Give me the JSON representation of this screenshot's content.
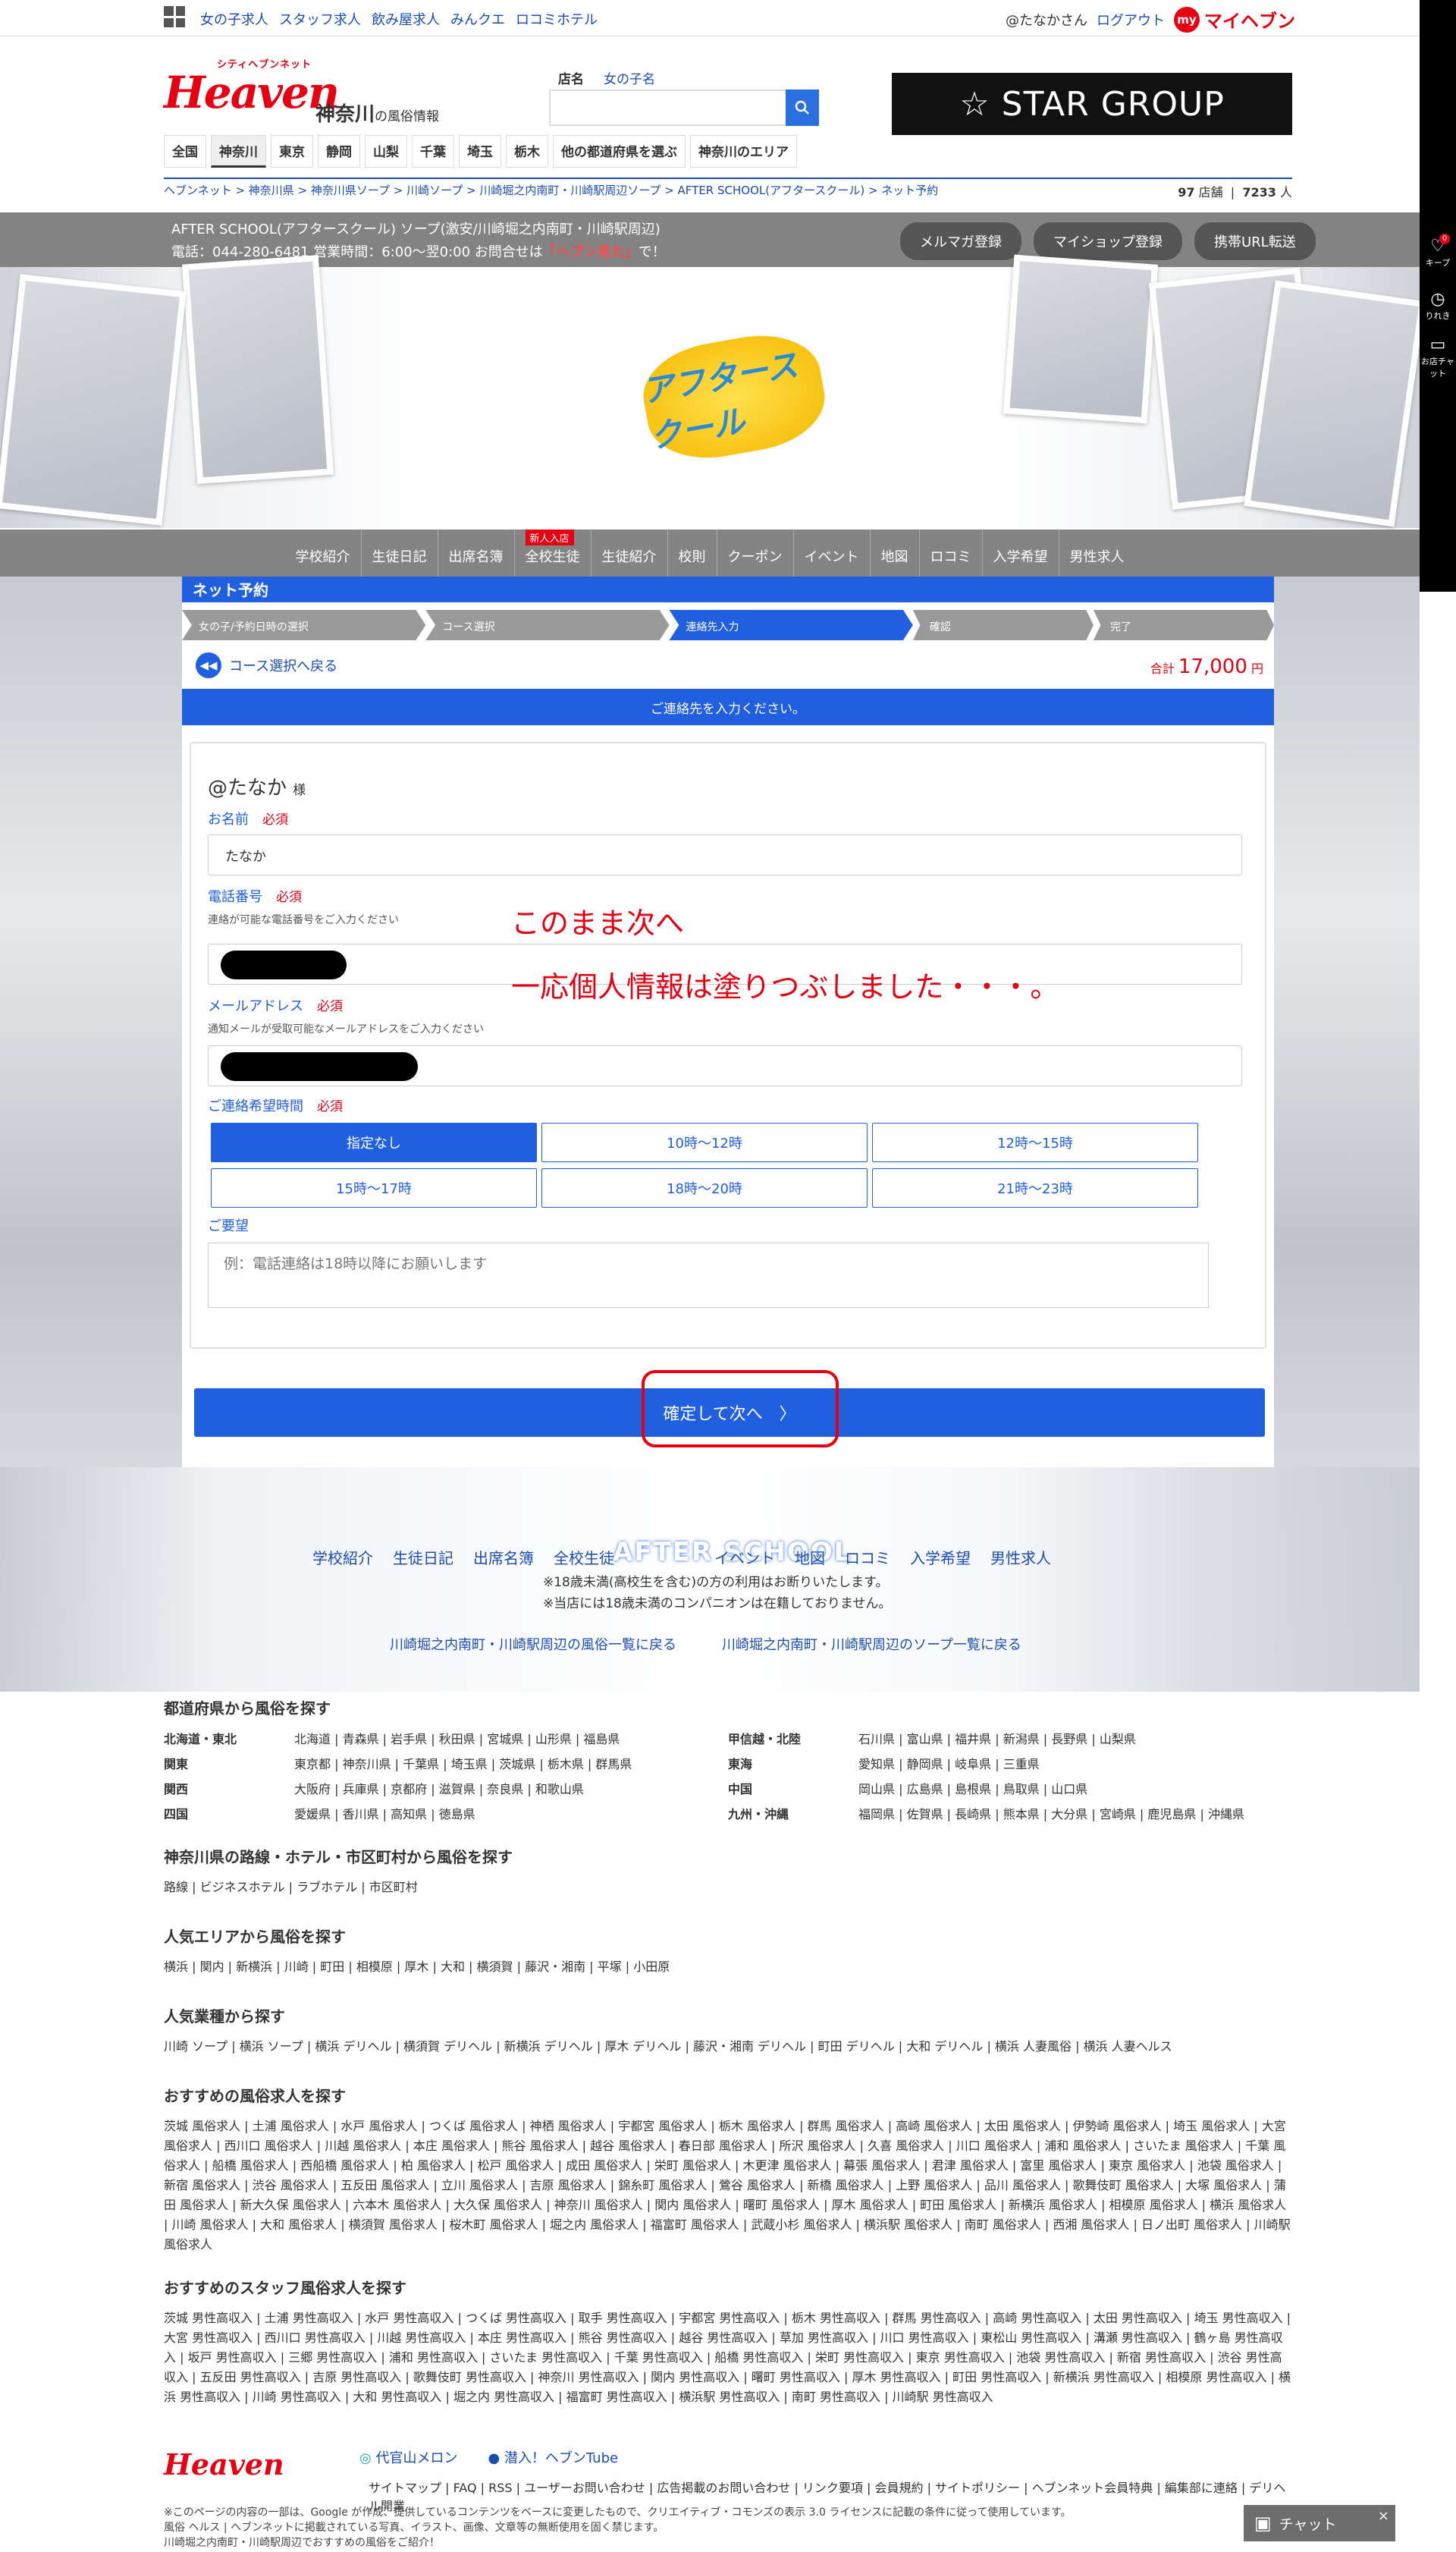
{
  "topbar": {
    "nav": [
      "女の子求人",
      "スタッフ求人",
      "飲み屋求人",
      "みんクエ",
      "ロコミホテル"
    ],
    "user": "@たなかさん",
    "logout": "ログアウト",
    "myheaven_icon": "my",
    "myheaven": "マイヘブン"
  },
  "header": {
    "logo_small": "シティヘブンネット",
    "logo": "Heaven",
    "region": "神奈川",
    "region_suffix": "の風俗情報",
    "search_tabs": [
      "店名",
      "女の子名"
    ],
    "banner": "☆ STAR GROUP",
    "prefs": [
      "全国",
      "神奈川",
      "東京",
      "静岡",
      "山梨",
      "千葉",
      "埼玉",
      "栃木",
      "他の都道府県を選ぶ",
      "神奈川のエリア"
    ]
  },
  "breadcrumb": {
    "text": "ヘブンネット > 神奈川県 > 神奈川県ソープ > 川崎ソープ > 川崎堀之内南町・川崎駅周辺ソープ > AFTER SCHOOL(アフタースクール) > ネット予約",
    "shops": "97",
    "shops_unit": "店舗",
    "people": "7233",
    "people_unit": "人"
  },
  "shop": {
    "name": "AFTER SCHOOL(アフタースクール) ソープ(激安/川崎堀之内南町・川崎駅周辺)",
    "phone_prefix": "電話：044-280-6481 営業時間：6:00〜翌0:00 お問合せは",
    "phone_em": "「ヘブン見た」",
    "phone_suffix": "で！",
    "buttons": [
      "メルマガ登録",
      "マイショップ登録",
      "携帯URL転送"
    ],
    "logo_text": "アフタースクール"
  },
  "menu": {
    "items": [
      "学校紹介",
      "生徒日記",
      "出席名簿",
      "全校生徒",
      "生徒紹介",
      "校則",
      "クーポン",
      "イベント",
      "地図",
      "ロコミ",
      "入学希望",
      "男性求人"
    ],
    "new_badge": "新人入店"
  },
  "reserve": {
    "title": "ネット予約",
    "steps": [
      "女の子/予約日時の選択",
      "コース選択",
      "連絡先入力",
      "確認",
      "完了"
    ],
    "back": "コース選択へ戻る",
    "total_label": "合計",
    "total_value": "17,000",
    "total_unit": "円",
    "notice": "ご連絡先を入力ください。",
    "greet": "@たなか",
    "greet_suffix": "様",
    "name_label": "お名前",
    "required": "必須",
    "name_value": "たなか",
    "tel_label": "電話番号",
    "tel_note": "連絡が可能な電話番号をご入力ください",
    "mail_label": "メールアドレス",
    "mail_note": "通知メールが受取可能なメールアドレスをご入力ください",
    "time_label": "ご連絡希望時間",
    "times": [
      "指定なし",
      "10時〜12時",
      "12時〜15時",
      "15時〜17時",
      "18時〜20時",
      "21時〜23時"
    ],
    "request_label": "ご要望",
    "request_placeholder": "例：電話連絡は18時以降にお願いします",
    "confirm": "確定して次へ　〉"
  },
  "annotation": {
    "line1": "このまま次へ",
    "line2": "一応個人情報は塗りつぶしました・・・。"
  },
  "lower": {
    "school": "AFTER SCHOOL",
    "note1": "※18歳未満(高校生を含む)の方の利用はお断りいたします。",
    "note2": "※当店には18歳未満のコンパニオンは在籍しておりません。",
    "link1": "川崎堀之内南町・川崎駅周辺の風俗一覧に戻る",
    "link2": "川崎堀之内南町・川崎駅周辺のソープ一覧に戻る"
  },
  "footer": {
    "pref_title": "都道府県から風俗を探す",
    "regions": [
      {
        "k": "北海道・東北",
        "v": "北海道 | 青森県 | 岩手県 | 秋田県 | 宮城県 | 山形県 | 福島県"
      },
      {
        "k": "甲信越・北陸",
        "v": "石川県 | 富山県 | 福井県 | 新潟県 | 長野県 | 山梨県"
      },
      {
        "k": "関東",
        "v": "東京都 | 神奈川県 | 千葉県 | 埼玉県 | 茨城県 | 栃木県 | 群馬県"
      },
      {
        "k": "東海",
        "v": "愛知県 | 静岡県 | 岐阜県 | 三重県"
      },
      {
        "k": "関西",
        "v": "大阪府 | 兵庫県 | 京都府 | 滋賀県 | 奈良県 | 和歌山県"
      },
      {
        "k": "中国",
        "v": "岡山県 | 広島県 | 島根県 | 鳥取県 | 山口県"
      },
      {
        "k": "四国",
        "v": "愛媛県 | 香川県 | 高知県 | 徳島県"
      },
      {
        "k": "九州・沖縄",
        "v": "福岡県 | 佐賀県 | 長崎県 | 熊本県 | 大分県 | 宮崎県 | 鹿児島県 | 沖縄県"
      }
    ],
    "route_title": "神奈川県の路線・ホテル・市区町村から風俗を探す",
    "route": "路線 | ビジネスホテル | ラブホテル | 市区町村",
    "area_title": "人気エリアから風俗を探す",
    "area": "横浜 | 関内 | 新横浜 | 川崎 | 町田 | 相模原 | 厚木 | 大和 | 横須賀 | 藤沢・湘南 | 平塚 | 小田原",
    "genre_title": "人気業種から探す",
    "genre": "川崎 ソープ | 横浜 ソープ | 横浜 デリヘル | 横須賀 デリヘル | 新横浜 デリヘル | 厚木 デリヘル | 藤沢・湘南 デリヘル | 町田 デリヘル | 大和 デリヘル | 横浜 人妻風俗 | 横浜 人妻ヘルス",
    "job_title": "おすすめの風俗求人を探す",
    "job": "茨城 風俗求人 | 土浦 風俗求人 | 水戸 風俗求人 | つくば 風俗求人 | 神栖 風俗求人 | 宇都宮 風俗求人 | 栃木 風俗求人 | 群馬 風俗求人 | 高崎 風俗求人 | 太田 風俗求人 | 伊勢崎 風俗求人 | 埼玉 風俗求人 | 大宮 風俗求人 | 西川口 風俗求人 | 川越 風俗求人 | 本庄 風俗求人 | 熊谷 風俗求人 | 越谷 風俗求人 | 春日部 風俗求人 | 所沢 風俗求人 | 久喜 風俗求人 | 川口 風俗求人 | 浦和 風俗求人 | さいたま 風俗求人 | 千葉 風俗求人 | 船橋 風俗求人 | 西船橋 風俗求人 | 柏 風俗求人 | 松戸 風俗求人 | 成田 風俗求人 | 栄町 風俗求人 | 木更津 風俗求人 | 幕張 風俗求人 | 君津 風俗求人 | 富里 風俗求人 | 東京 風俗求人 | 池袋 風俗求人 | 新宿 風俗求人 | 渋谷 風俗求人 | 五反田 風俗求人 | 立川 風俗求人 | 吉原 風俗求人 | 錦糸町 風俗求人 | 鶯谷 風俗求人 | 新橋 風俗求人 | 上野 風俗求人 | 品川 風俗求人 | 歌舞伎町 風俗求人 | 大塚 風俗求人 | 蒲田 風俗求人 | 新大久保 風俗求人 | 六本木 風俗求人 | 大久保 風俗求人 | 神奈川 風俗求人 | 関内 風俗求人 | 曙町 風俗求人 | 厚木 風俗求人 | 町田 風俗求人 | 新横浜 風俗求人 | 相模原 風俗求人 | 横浜 風俗求人 | 川崎 風俗求人 | 大和 風俗求人 | 横須賀 風俗求人 | 桜木町 風俗求人 | 堀之内 風俗求人 | 福富町 風俗求人 | 武蔵小杉 風俗求人 | 横浜駅 風俗求人 | 南町 風俗求人 | 西湘 風俗求人 | 日ノ出町 風俗求人 | 川崎駅 風俗求人",
    "staff_title": "おすすめのスタッフ風俗求人を探す",
    "staff": "茨城 男性高収入 | 土浦 男性高収入 | 水戸 男性高収入 | つくば 男性高収入 | 取手 男性高収入 | 宇都宮 男性高収入 | 栃木 男性高収入 | 群馬 男性高収入 | 高崎 男性高収入 | 太田 男性高収入 | 埼玉 男性高収入 | 大宮 男性高収入 | 西川口 男性高収入 | 川越 男性高収入 | 本庄 男性高収入 | 熊谷 男性高収入 | 越谷 男性高収入 | 草加 男性高収入 | 川口 男性高収入 | 東松山 男性高収入 | 溝瀬 男性高収入 | 鶴ヶ島 男性高収入 | 坂戸 男性高収入 | 三郷 男性高収入 | 浦和 男性高収入 | さいたま 男性高収入 | 千葉 男性高収入 | 船橋 男性高収入 | 栄町 男性高収入 | 東京 男性高収入 | 池袋 男性高収入 | 新宿 男性高収入 | 渋谷 男性高収入 | 五反田 男性高収入 | 吉原 男性高収入 | 歌舞伎町 男性高収入 | 神奈川 男性高収入 | 関内 男性高収入 | 曙町 男性高収入 | 厚木 男性高収入 | 町田 男性高収入 | 新横浜 男性高収入 | 相模原 男性高収入 | 横浜 男性高収入 | 川崎 男性高収入 | 大和 男性高収入 | 堀之内 男性高収入 | 福富町 男性高収入 | 横浜駅 男性高収入 | 南町 男性高収入 | 川崎駅 男性高収入",
    "logo": "Heaven",
    "melon": "代官山メロン",
    "tube": "潜入！ヘブンTube",
    "links": "サイトマップ | FAQ | RSS | ユーザーお問い合わせ | 広告掲載のお問い合わせ | リンク要項 | 会員規約 | サイトポリシー | ヘブンネット会員特典 | 編集部に連絡 | デリヘル開業",
    "copy1": "※このページの内容の一部は、Google が作成、提供しているコンテンツをベースに変更したもので、クリエイティブ・コモンズの表示 3.0 ライセンスに記載の条件に従って使用しています。",
    "copy2": "風俗 ヘルス | ヘブンネットに掲載されている写真、イラスト、画像、文章等の無断使用を固く禁じます。",
    "copy3": "川崎堀之内南町・川崎駅周辺でおすすめの風俗をご紹介！"
  },
  "sidebar": {
    "keep": "キープ",
    "keep_count": "0",
    "history": "りれき",
    "chat": "お店チャット"
  },
  "chat": {
    "label": "チャット",
    "close": "×"
  },
  "colors": {
    "accent": "#1f5fe0",
    "brand": "#e60012"
  }
}
